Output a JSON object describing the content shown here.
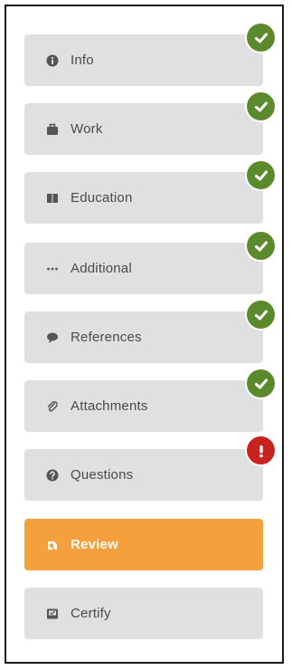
{
  "steps": [
    {
      "label": "Info",
      "icon": "info-icon",
      "status": "complete"
    },
    {
      "label": "Work",
      "icon": "briefcase-icon",
      "status": "complete"
    },
    {
      "label": "Education",
      "icon": "book-icon",
      "status": "complete"
    },
    {
      "label": "Additional",
      "icon": "ellipsis-icon",
      "status": "complete"
    },
    {
      "label": "References",
      "icon": "speech-bubble-icon",
      "status": "complete"
    },
    {
      "label": "Attachments",
      "icon": "paperclip-icon",
      "status": "complete"
    },
    {
      "label": "Questions",
      "icon": "question-icon",
      "status": "error"
    },
    {
      "label": "Review",
      "icon": "review-icon",
      "status": "current"
    },
    {
      "label": "Certify",
      "icon": "certify-icon",
      "status": "pending"
    }
  ],
  "colors": {
    "step_bg": "#e0e0e0",
    "active_bg": "#f5a03c",
    "complete_badge": "#5a8a2b",
    "error_badge": "#c8231f",
    "label_text": "#4a4a4a"
  }
}
